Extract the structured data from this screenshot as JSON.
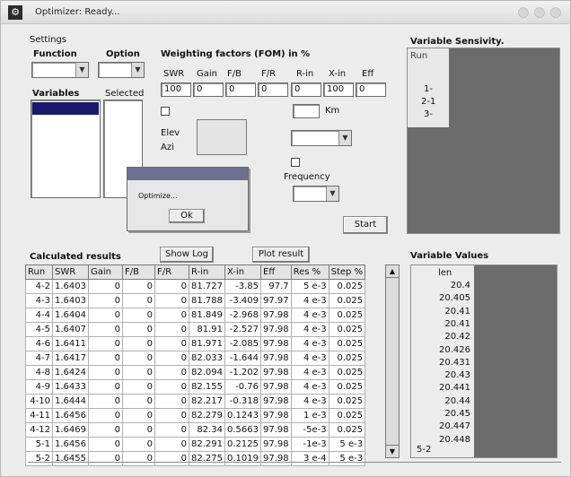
{
  "window": {
    "title": "Optimizer: Ready..."
  },
  "settings": {
    "group_label": "Settings",
    "function_label": "Function",
    "function_value": "",
    "option_label": "Option",
    "option_value": "",
    "variables_label": "Variables",
    "selected_label": "Selected"
  },
  "weighting": {
    "title": "Weighting factors (FOM) in %",
    "headers": [
      "SWR",
      "Gain",
      "F/B",
      "F/R",
      "R-in",
      "X-in",
      "Eff"
    ],
    "values": [
      "100",
      "0",
      "0",
      "0",
      "0",
      "100",
      "0"
    ]
  },
  "options": {
    "km_label": "Km",
    "elev_label": "Elev",
    "azi_label": "Azi",
    "frequency_label": "Frequency",
    "frequency_value": "",
    "band_value": "",
    "start_label": "Start"
  },
  "dialog": {
    "message": "Optimize...",
    "ok_label": "Ok"
  },
  "results": {
    "title": "Calculated results",
    "show_log_label": "Show Log",
    "plot_label": "Plot result",
    "columns": [
      "Run",
      "SWR",
      "Gain",
      "F/B",
      "F/R",
      "R-in",
      "X-in",
      "Eff",
      "Res %",
      "Step %"
    ],
    "rows": [
      [
        "4-2",
        "1.6403",
        "0",
        "0",
        "0",
        "81.727",
        "-3.85",
        "97.7",
        "5 e-3",
        "0.025"
      ],
      [
        "4-3",
        "1.6403",
        "0",
        "0",
        "0",
        "81.788",
        "-3.409",
        "97.97",
        "4 e-3",
        "0.025"
      ],
      [
        "4-4",
        "1.6404",
        "0",
        "0",
        "0",
        "81.849",
        "-2.968",
        "97.98",
        "4 e-3",
        "0.025"
      ],
      [
        "4-5",
        "1.6407",
        "0",
        "0",
        "0",
        "81.91",
        "-2.527",
        "97.98",
        "4 e-3",
        "0.025"
      ],
      [
        "4-6",
        "1.6411",
        "0",
        "0",
        "0",
        "81.971",
        "-2.085",
        "97.98",
        "4 e-3",
        "0.025"
      ],
      [
        "4-7",
        "1.6417",
        "0",
        "0",
        "0",
        "82.033",
        "-1.644",
        "97.98",
        "4 e-3",
        "0.025"
      ],
      [
        "4-8",
        "1.6424",
        "0",
        "0",
        "0",
        "82.094",
        "-1.202",
        "97.98",
        "4 e-3",
        "0.025"
      ],
      [
        "4-9",
        "1.6433",
        "0",
        "0",
        "0",
        "82.155",
        "-0.76",
        "97.98",
        "4 e-3",
        "0.025"
      ],
      [
        "4-10",
        "1.6444",
        "0",
        "0",
        "0",
        "82.217",
        "-0.318",
        "97.98",
        "4 e-3",
        "0.025"
      ],
      [
        "4-11",
        "1.6456",
        "0",
        "0",
        "0",
        "82.279",
        "0.1243",
        "97.98",
        "1 e-3",
        "0.025"
      ],
      [
        "4-12",
        "1.6469",
        "0",
        "0",
        "0",
        "82.34",
        "0.5663",
        "97.98",
        "-5e-3",
        "0.025"
      ],
      [
        "5-1",
        "1.6456",
        "0",
        "0",
        "0",
        "82.291",
        "0.2125",
        "97.98",
        "-1e-3",
        "5 e-3"
      ],
      [
        "5-2",
        "1.6455",
        "0",
        "0",
        "0",
        "82.275",
        "0.1019",
        "97.98",
        "3 e-4",
        "5 e-3"
      ]
    ]
  },
  "sensitivity": {
    "title": "Variable Sensivity.",
    "header": "Run",
    "runs": [
      "1-",
      "2-1",
      "3-"
    ]
  },
  "values_panel": {
    "title": "Variable Values",
    "header": "len",
    "values": [
      "20.4",
      "20.405",
      "20.41",
      "20.41",
      "20.42",
      "20.426",
      "20.431",
      "20.43",
      "20.441",
      "20.44",
      "20.45",
      "20.447",
      "20.448"
    ],
    "last_run": "5-2"
  },
  "colors": {
    "window_bg": "#ececec",
    "panel_dark": "#6c6c6c",
    "field_bg": "#ffffff"
  }
}
